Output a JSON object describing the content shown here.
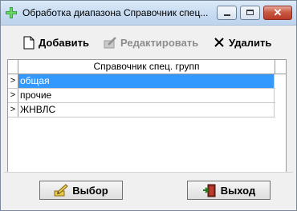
{
  "window": {
    "title": "Обработка диапазона Справочник спец..."
  },
  "toolbar": {
    "add_label": "Добавить",
    "edit_label": "Редактировать",
    "delete_label": "Удалить"
  },
  "grid": {
    "column_header": "Справочник спец. групп",
    "row_indicator": ">",
    "rows": [
      {
        "value": "общая",
        "selected": true
      },
      {
        "value": "прочие",
        "selected": false
      },
      {
        "value": "ЖНВЛС",
        "selected": false
      }
    ]
  },
  "buttons": {
    "select_label": "Выбор",
    "exit_label": "Выход"
  },
  "colors": {
    "selection": "#3399ff",
    "title_bar": "#c7dbf1",
    "close_button": "#c95a44"
  },
  "icons": {
    "app": "green-cross-icon",
    "add": "new-document-icon",
    "edit": "edit-pencil-icon",
    "delete": "x-scissors-icon",
    "select": "pencil-select-icon",
    "exit": "exit-door-icon"
  }
}
